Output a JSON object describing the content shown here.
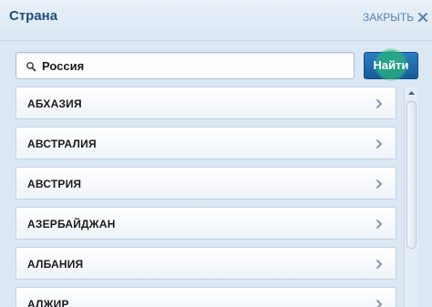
{
  "header": {
    "title": "Страна",
    "close_label": "ЗАКРЫТЬ"
  },
  "search": {
    "value": "Россия",
    "button_label": "Найти"
  },
  "countries": [
    {
      "name": "АБХАЗИЯ"
    },
    {
      "name": "АВСТРАЛИЯ"
    },
    {
      "name": "АВСТРИЯ"
    },
    {
      "name": "АЗЕРБАЙДЖАН"
    },
    {
      "name": "АЛБАНИЯ"
    },
    {
      "name": "АЛЖИР"
    }
  ],
  "colors": {
    "title": "#1d4f7c",
    "button": "#1f6fb2",
    "panel": "#dbe7f3"
  }
}
